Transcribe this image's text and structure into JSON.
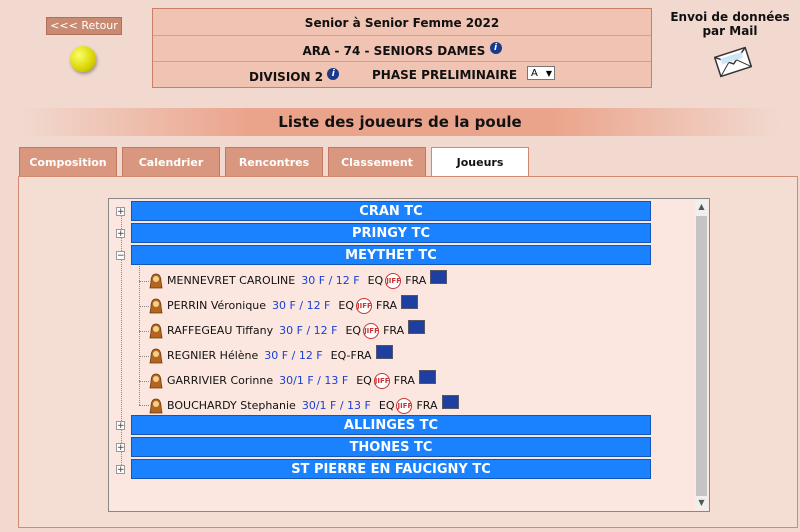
{
  "header": {
    "back_label": "<<< Retour",
    "competition": "Senior  à Senior  Femme  2022",
    "league": "ARA - 74 - SENIORS DAMES",
    "division": "DIVISION 2",
    "phase": "PHASE PRELIMINAIRE",
    "poule_value": "A",
    "mail_label": "Envoi de données par Mail"
  },
  "page_title": "Liste des joueurs de la poule",
  "tabs": [
    {
      "label": "Composition"
    },
    {
      "label": "Calendrier"
    },
    {
      "label": "Rencontres"
    },
    {
      "label": "Classement"
    },
    {
      "label": "Joueurs"
    }
  ],
  "clubs": [
    {
      "name": "CRAN TC",
      "toggle": "+"
    },
    {
      "name": "PRINGY TC",
      "toggle": "+"
    },
    {
      "name": "MEYTHET TC",
      "toggle": "−"
    },
    {
      "name": "ALLINGES TC",
      "toggle": "+"
    },
    {
      "name": "THONES TC",
      "toggle": "+"
    },
    {
      "name": "ST PIERRE EN FAUCIGNY TC",
      "toggle": "+"
    }
  ],
  "players": [
    {
      "name": "MENNEVRET CAROLINE",
      "rank": "30 F / 12 F",
      "eq": "EQ",
      "nat": "FRA"
    },
    {
      "name": "PERRIN Véronique",
      "rank": "30 F / 12 F",
      "eq": "EQ",
      "nat": "FRA"
    },
    {
      "name": "RAFFEGEAU Tiffany",
      "rank": "30 F / 12 F",
      "eq": "EQ",
      "nat": "FRA"
    },
    {
      "name": "REGNIER Hélène",
      "rank": "30 F / 12 F",
      "eq": "EQ-FRA",
      "nat": ""
    },
    {
      "name": "GARRIVIER Corinne",
      "rank": "30/1 F / 13 F",
      "eq": "EQ",
      "nat": "FRA"
    },
    {
      "name": "BOUCHARDY Stephanie",
      "rank": "30/1 F / 13 F",
      "eq": "EQ",
      "nat": "FRA"
    }
  ],
  "icons": {
    "info": "info-icon",
    "tennis_ball": "tennis-ball-icon",
    "mail": "envelope-icon",
    "player": "female-player-icon",
    "ffta": "jiff-logo-icon",
    "flag": "eu-flag-icon"
  },
  "colors": {
    "club_header": "#1a82ff",
    "tab_inactive": "#d9977f",
    "rank_text": "#1a3fd1"
  }
}
